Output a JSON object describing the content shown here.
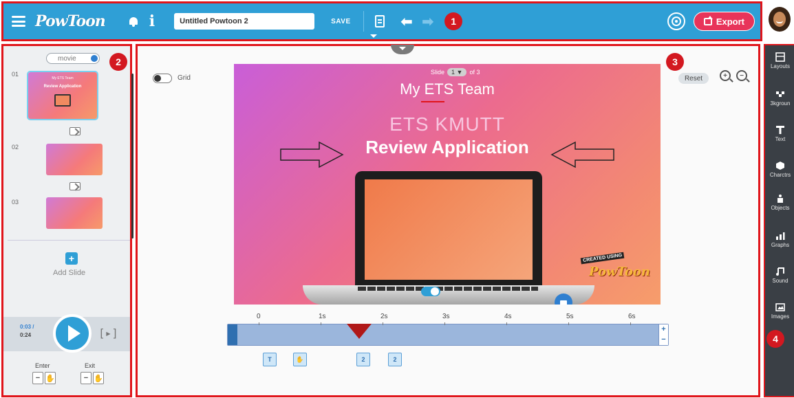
{
  "header": {
    "logo_text": "PowToon",
    "project_title": "Untitled Powtoon 2",
    "save_label": "SAVE",
    "export_label": "Export",
    "badge": "1"
  },
  "left_panel": {
    "badge": "2",
    "movie_toggle_label": "movie",
    "slides": [
      {
        "number": "01",
        "title_small": "My ETS Team",
        "title_mid": "ETS KMUTT",
        "title_main": "Review Application"
      },
      {
        "number": "02"
      },
      {
        "number": "03"
      }
    ],
    "add_slide_label": "Add Slide",
    "player": {
      "current_time": "0:03 /",
      "total_time": "0:24"
    },
    "enter_label": "Enter",
    "exit_label": "Exit"
  },
  "canvas": {
    "badge": "3",
    "grid_label": "Grid",
    "reset_label": "Reset",
    "slide_pager": {
      "prefix": "Slide",
      "current": "1",
      "suffix": "of 3"
    },
    "slide_title_1": "My ETS Team",
    "slide_title_2": "ETS KMUTT",
    "slide_title_3": "Review Application",
    "created_using": "CREATED USING",
    "powtoon_mark": "PowToon",
    "timeline_ticks": [
      "0",
      "1s",
      "2s",
      "3s",
      "4s",
      "5s",
      "6s"
    ],
    "timeline_items": [
      "T",
      "",
      "2",
      "2"
    ]
  },
  "right_toolbar": {
    "badge": "4",
    "tools": [
      {
        "label": "Layouts",
        "icon": "layouts-icon"
      },
      {
        "label": "3kgroun",
        "icon": "background-icon"
      },
      {
        "label": "Text",
        "icon": "text-icon"
      },
      {
        "label": "Charctrs",
        "icon": "characters-icon"
      },
      {
        "label": "Objects",
        "icon": "objects-icon"
      },
      {
        "label": "Graphs",
        "icon": "graphs-icon"
      },
      {
        "label": "Sound",
        "icon": "sound-icon"
      },
      {
        "label": "Images",
        "icon": "images-icon"
      }
    ]
  },
  "colors": {
    "topbar": "#2f9fd6",
    "export": "#e8345a",
    "annotation_red": "#e0141a",
    "right_toolbar": "#3a3f45"
  }
}
